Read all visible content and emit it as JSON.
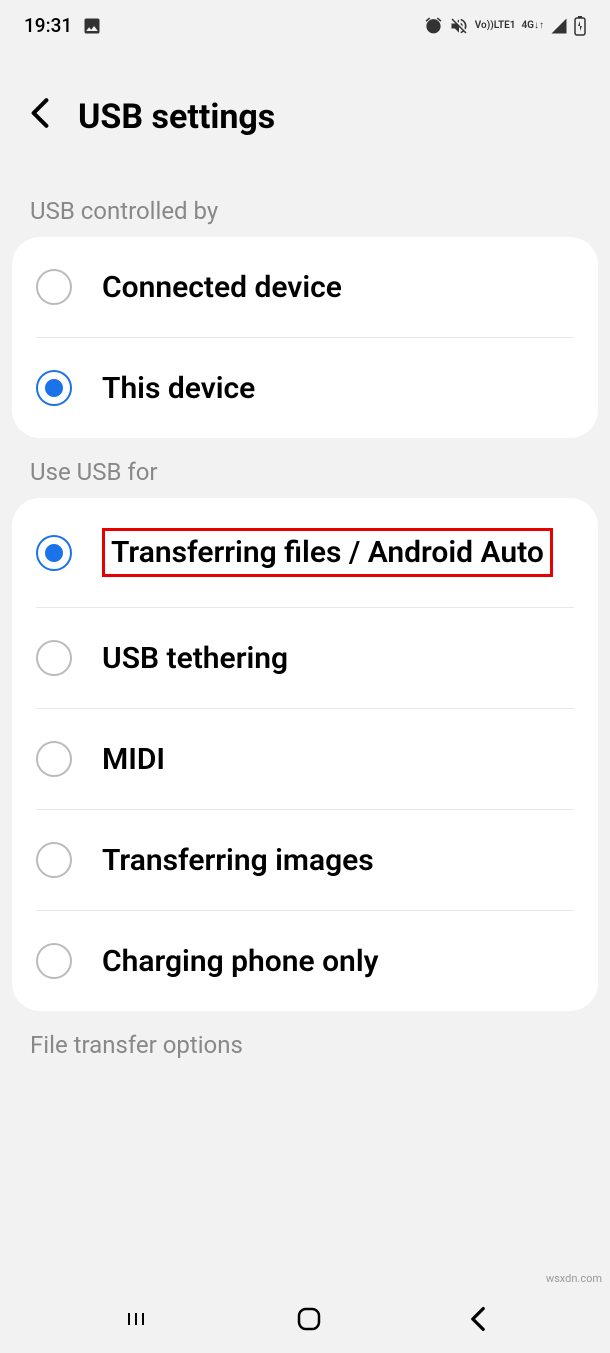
{
  "status_bar": {
    "time": "19:31",
    "volte": "Vo))",
    "lte": "LTE1",
    "network": "4G"
  },
  "header": {
    "title": "USB settings"
  },
  "sections": {
    "controlled_by": {
      "label": "USB controlled by",
      "options": {
        "connected": "Connected device",
        "this_device": "This device"
      }
    },
    "use_for": {
      "label": "Use USB for",
      "options": {
        "transferring_files": "Transferring files / Android Auto",
        "tethering": "USB tethering",
        "midi": "MIDI",
        "images": "Transferring images",
        "charging": "Charging phone only"
      }
    },
    "file_transfer": {
      "label": "File transfer options"
    }
  },
  "watermark": "wsxdn.com"
}
